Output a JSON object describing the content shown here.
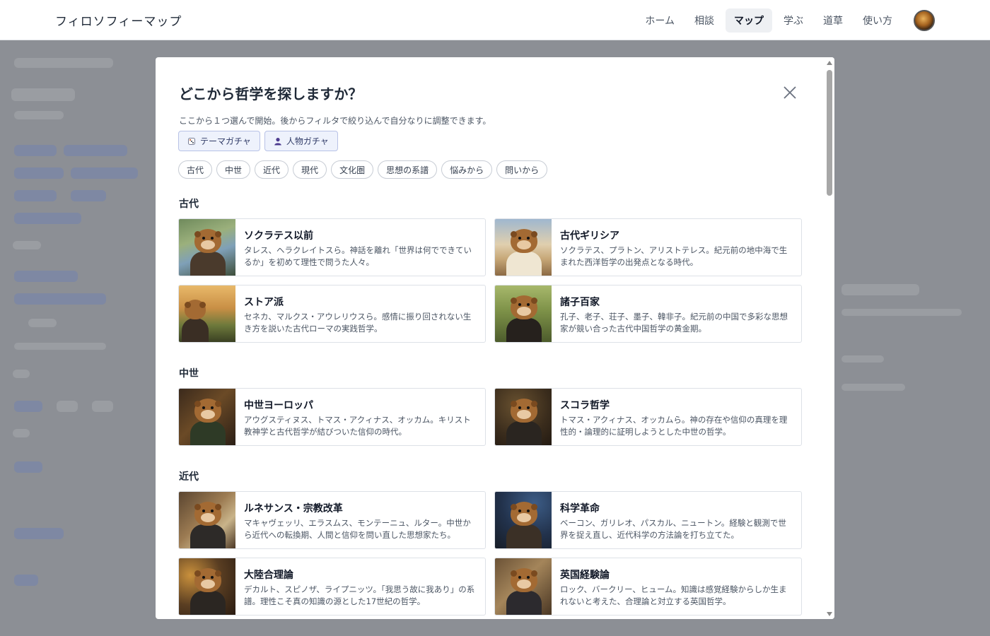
{
  "header": {
    "logo": "フィロソフィーマップ",
    "nav": [
      {
        "label": "ホーム",
        "active": false
      },
      {
        "label": "相談",
        "active": false
      },
      {
        "label": "マップ",
        "active": true
      },
      {
        "label": "学ぶ",
        "active": false
      },
      {
        "label": "道草",
        "active": false
      },
      {
        "label": "使い方",
        "active": false
      }
    ]
  },
  "modal": {
    "title": "どこから哲学を探しますか？",
    "subtitle": "ここから１つ選んで開始。後からフィルタで絞り込んで自分なりに調整できます。",
    "gacha": [
      {
        "label": "テーマガチャ",
        "icon": "dice-icon"
      },
      {
        "label": "人物ガチャ",
        "icon": "person-icon"
      }
    ],
    "chips": [
      "古代",
      "中世",
      "近代",
      "現代",
      "文化圏",
      "思想の系譜",
      "悩みから",
      "問いから"
    ],
    "sections": [
      {
        "heading": "古代",
        "cards": [
          {
            "title": "ソクラテス以前",
            "desc": "タレス、ヘラクレイトスら。神話を離れ「世界は何でできているか」を初めて理性で問うた人々。"
          },
          {
            "title": "古代ギリシア",
            "desc": "ソクラテス、プラトン、アリストテレス。紀元前の地中海で生まれた西洋哲学の出発点となる時代。"
          },
          {
            "title": "ストア派",
            "desc": "セネカ、マルクス・アウレリウスら。感情に振り回されない生き方を説いた古代ローマの実践哲学。"
          },
          {
            "title": "諸子百家",
            "desc": "孔子、老子、荘子、墨子、韓非子。紀元前の中国で多彩な思想家が競い合った古代中国哲学の黄金期。"
          }
        ]
      },
      {
        "heading": "中世",
        "cards": [
          {
            "title": "中世ヨーロッパ",
            "desc": "アウグスティヌス、トマス・アクィナス、オッカム。キリスト教神学と古代哲学が結びついた信仰の時代。"
          },
          {
            "title": "スコラ哲学",
            "desc": "トマス・アクィナス、オッカムら。神の存在や信仰の真理を理性的・論理的に証明しようとした中世の哲学。"
          }
        ]
      },
      {
        "heading": "近代",
        "cards": [
          {
            "title": "ルネサンス・宗教改革",
            "desc": "マキャヴェッリ、エラスムス、モンテーニュ、ルター。中世から近代への転換期、人間と信仰を問い直した思想家たち。"
          },
          {
            "title": "科学革命",
            "desc": "ベーコン、ガリレオ、パスカル、ニュートン。経験と観測で世界を捉え直し、近代科学の方法論を打ち立てた。"
          },
          {
            "title": "大陸合理論",
            "desc": "デカルト、スピノザ、ライプニッツ。「我思う故に我あり」の系譜。理性こそ真の知識の源とした17世紀の哲学。"
          },
          {
            "title": "英国経験論",
            "desc": "ロック、バークリー、ヒューム。知識は感覚経験からしか生まれないと考えた、合理論と対立する英国哲学。"
          }
        ]
      }
    ]
  }
}
